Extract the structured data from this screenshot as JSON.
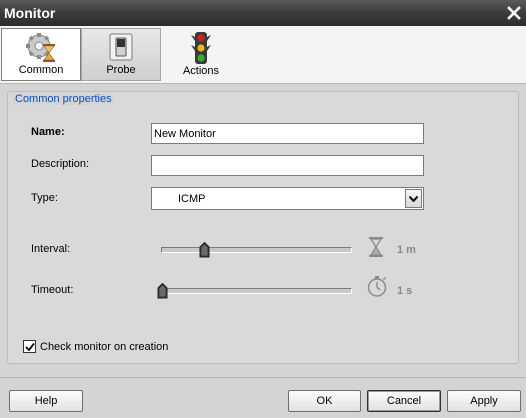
{
  "window": {
    "title": "Monitor"
  },
  "toolbar": {
    "items": [
      {
        "label": "Common",
        "icon": "gear-hourglass-icon",
        "selected": true
      },
      {
        "label": "Probe",
        "icon": "switch-icon",
        "selected": false
      },
      {
        "label": "Actions",
        "icon": "traffic-light-icon",
        "selected": false
      }
    ]
  },
  "section": {
    "title": "Common properties"
  },
  "form": {
    "name_label": "Name:",
    "name_value": "New Monitor",
    "description_label": "Description:",
    "description_value": "",
    "type_label": "Type:",
    "type_value": "ICMP",
    "interval_label": "Interval:",
    "interval_value": "1 m",
    "interval_icon": "hourglass-icon",
    "interval_fraction": 0.22,
    "timeout_label": "Timeout:",
    "timeout_value": "1 s",
    "timeout_icon": "stopwatch-icon",
    "timeout_fraction": 0.0,
    "check_label": "Check monitor on creation",
    "check_checked": true
  },
  "buttons": {
    "help": "Help",
    "ok": "OK",
    "cancel": "Cancel",
    "apply": "Apply"
  },
  "colors": {
    "titlebar": "#3e3e3e",
    "section_title": "#0a50b5",
    "dialog_bg": "#d4d4d4"
  }
}
